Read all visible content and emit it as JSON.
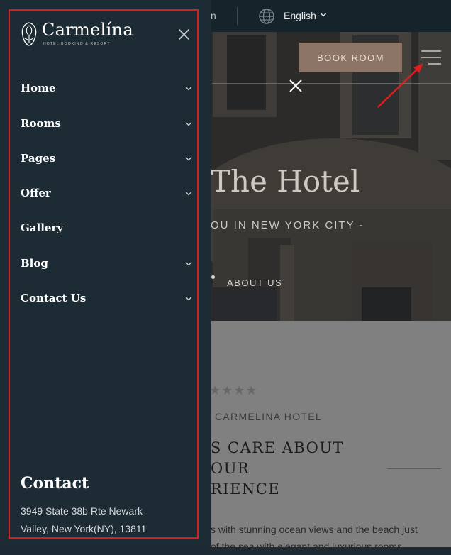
{
  "topbar": {
    "fragment": "n",
    "language": "English"
  },
  "hero": {
    "book_button": "BOOK ROOM",
    "title": "The Hotel",
    "subtitle": "OU IN NEW YORK CITY -",
    "breadcrumb": "ABOUT US"
  },
  "content": {
    "stars": "★★★★",
    "kicker": "CARMELINA HOTEL",
    "heading_line1": "S CARE ABOUT",
    "heading_line2": "OUR",
    "heading_line3": "RIENCE",
    "body_line1": "s with stunning ocean views and the beach just",
    "body_line2": "of the sea with elegant and luxurious rooms"
  },
  "side_menu": {
    "brand": "Carmelína",
    "tagline": "HOTEL BOOKING & RESORT",
    "items": [
      {
        "label": "Home",
        "has_submenu": true
      },
      {
        "label": "Rooms",
        "has_submenu": true
      },
      {
        "label": "Pages",
        "has_submenu": true
      },
      {
        "label": "Offer",
        "has_submenu": true
      },
      {
        "label": "Gallery",
        "has_submenu": false
      },
      {
        "label": "Blog",
        "has_submenu": true
      },
      {
        "label": "Contact Us",
        "has_submenu": true
      }
    ],
    "contact_title": "Contact",
    "contact_line1": "3949 State 38b Rte Newark",
    "contact_line2": "Valley, New York(NY), 13811"
  },
  "colors": {
    "panel_bg": "#1d2b35",
    "topbar_bg": "#15232b",
    "accent_button": "#8c7566",
    "highlight_frame": "#d42020",
    "content_bg": "#808080"
  },
  "icons": [
    "globe-icon",
    "chevron-down-icon",
    "hamburger-icon",
    "close-icon",
    "logo-icon",
    "arrow-annotation"
  ]
}
